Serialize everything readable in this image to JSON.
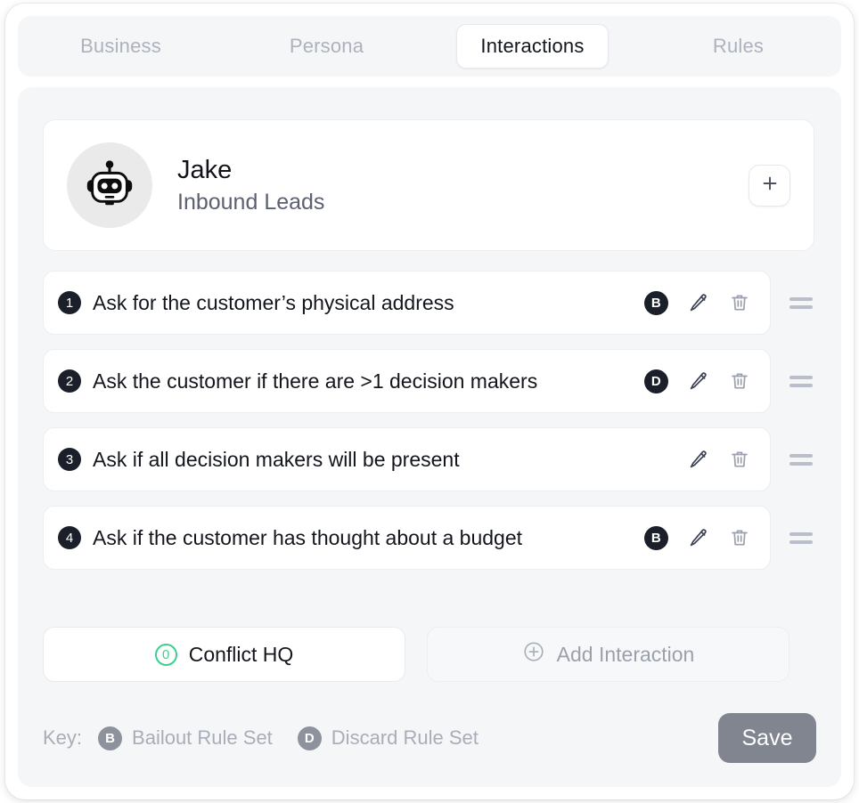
{
  "tabs": [
    {
      "label": "Business",
      "active": false
    },
    {
      "label": "Persona",
      "active": false
    },
    {
      "label": "Interactions",
      "active": true
    },
    {
      "label": "Rules",
      "active": false
    }
  ],
  "agent": {
    "name": "Jake",
    "subtitle": "Inbound Leads",
    "avatar_icon": "robot-icon",
    "add_button_icon": "plus-icon"
  },
  "interactions": [
    {
      "number": "1",
      "text": "Ask for the customer’s physical address",
      "rule_badge": "B"
    },
    {
      "number": "2",
      "text": "Ask the customer if there are >1 decision makers",
      "rule_badge": "D"
    },
    {
      "number": "3",
      "text": "Ask if all decision makers will be present",
      "rule_badge": ""
    },
    {
      "number": "4",
      "text": "Ask if the customer has thought about a budget",
      "rule_badge": "B"
    }
  ],
  "actions": {
    "edit_icon": "pencil-icon",
    "delete_icon": "trash-icon",
    "drag_icon": "drag-handle-icon"
  },
  "bottom": {
    "conflict_label": "Conflict HQ",
    "conflict_count": "0",
    "add_label": "Add Interaction",
    "add_icon": "plus-circle-icon"
  },
  "footer": {
    "key_label": "Key:",
    "keys": [
      {
        "badge": "B",
        "text": "Bailout Rule Set"
      },
      {
        "badge": "D",
        "text": "Discard Rule Set"
      }
    ],
    "save_label": "Save"
  },
  "colors": {
    "accent_green": "#3ecf8e",
    "badge_dark": "#1b1f2a",
    "save_gray": "#808590",
    "panel_bg": "#f5f6f8",
    "muted_text": "#a8adb8"
  }
}
